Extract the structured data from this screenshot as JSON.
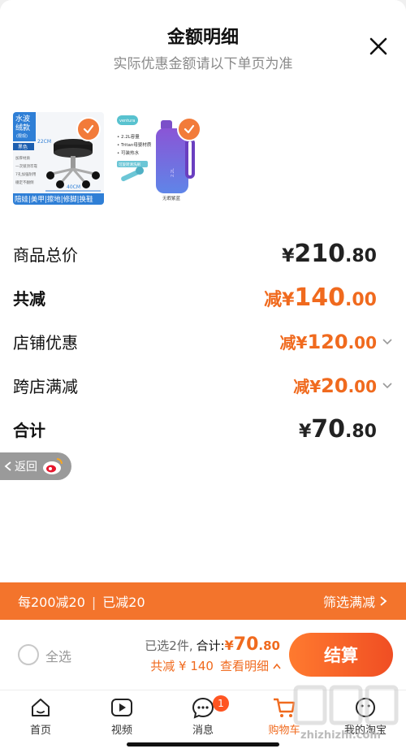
{
  "sheet": {
    "title": "金额明细",
    "subtitle": "实际优惠金额请以下单页为准"
  },
  "products": [
    {
      "name": "stool",
      "badge_top": "水波",
      "badge_sub": "绒款",
      "badge_note": "(限现)",
      "color_tag": "黑色",
      "size_h": "22CM",
      "size_w": "40CM",
      "features": [
        "加厚材质",
        "一次锁顶牢靠",
        "7孔加强耐用",
        "穩定不翻倒"
      ],
      "footer": "陪娃|美甲|擦地|修脚|换鞋"
    },
    {
      "name": "bottle",
      "brand": "ventura",
      "lines": [
        "• 2.2L容量",
        "• Tritan母婴材质",
        "• 可装热水"
      ],
      "brush_tag": "可旋转清洗刷",
      "caption": "无暇紫蓝"
    }
  ],
  "summary": {
    "total_label": "商品总价",
    "total_prefix": "¥",
    "total_int": "210",
    "total_dec": ".80",
    "reduce_label": "共减",
    "reduce_prefix": "减¥",
    "reduce_int": "140",
    "reduce_dec": ".00",
    "shop_label": "店铺优惠",
    "shop_prefix": "减¥",
    "shop_int": "120",
    "shop_dec": ".00",
    "cross_label": "跨店满减",
    "cross_prefix": "减¥",
    "cross_int": "20",
    "cross_dec": ".00",
    "sum_label": "合计",
    "sum_prefix": "¥",
    "sum_int": "70",
    "sum_dec": ".80"
  },
  "back_pill": {
    "label": "返回"
  },
  "promo": {
    "rule": "每200减20",
    "sep": "|",
    "applied": "已减20",
    "filter": "筛选满减"
  },
  "checkout": {
    "select_all": "全选",
    "selected": "已选2件,",
    "total_label": "合计:",
    "total_prefix": "¥",
    "total_int": "70",
    "total_dec": ".80",
    "reduce_text": "共减 ¥ 140",
    "details": "查看明细",
    "pay_button": "结算"
  },
  "tabbar": {
    "tabs": [
      {
        "label": "首页"
      },
      {
        "label": "视频"
      },
      {
        "label": "消息",
        "badge": "1"
      },
      {
        "label": "购物车"
      },
      {
        "label": "我的淘宝"
      }
    ]
  },
  "watermark": {
    "url": "zhizhizhi.com"
  },
  "colors": {
    "accent": "#f06a1e",
    "promo_bar": "#f3742c",
    "check": "#f27b3a"
  }
}
